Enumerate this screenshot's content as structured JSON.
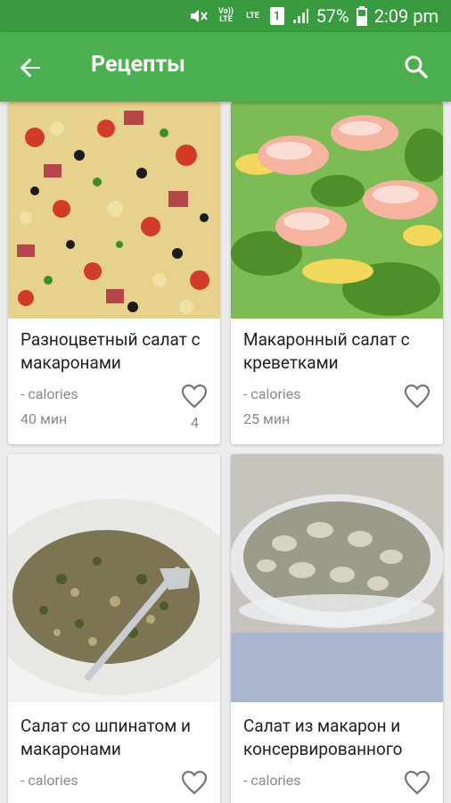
{
  "status_bar": {
    "volte": "Vo)) LTE",
    "lte": "LTE",
    "sim": "1",
    "battery": "57%",
    "time": "2:09 pm"
  },
  "app_bar": {
    "title": "Рецепты",
    "color": "#4cb050"
  },
  "recipes": [
    {
      "name": "Разноцветный салат с макаронами",
      "calories": "- calories",
      "time": "40 мин",
      "likes": "4"
    },
    {
      "name": "Макаронный салат с креветками",
      "calories": "- calories",
      "time": "25 мин",
      "likes": ""
    },
    {
      "name": "Салат со шпинатом и макаронами",
      "calories": "- calories",
      "time": "",
      "likes": ""
    },
    {
      "name": "Салат из макарон и консервированного",
      "calories": "- calories",
      "time": "",
      "likes": ""
    }
  ]
}
